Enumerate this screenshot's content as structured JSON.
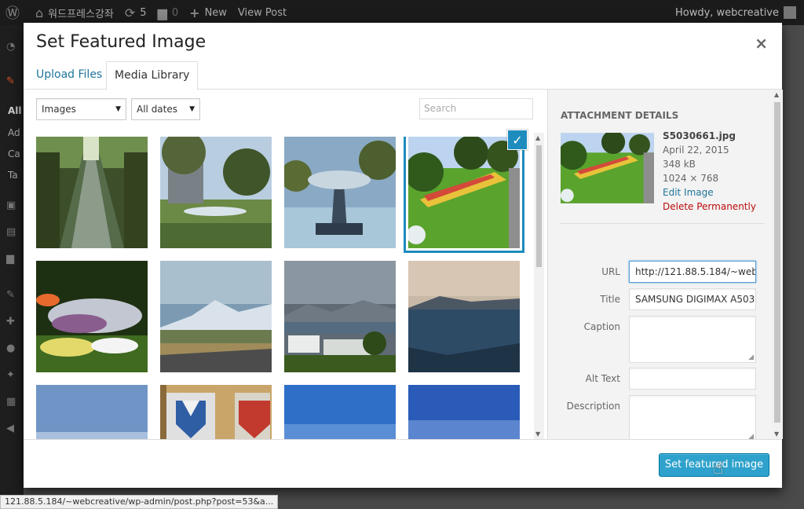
{
  "adminbar": {
    "site_name": "워드프레스강좌",
    "updates_count": "5",
    "comments_count": "0",
    "new_label": "New",
    "view_post_label": "View Post",
    "howdy": "Howdy, webcreative"
  },
  "menu": {
    "items_text": [
      "All",
      "Ad",
      "Ca",
      "Ta"
    ]
  },
  "modal": {
    "title": "Set Featured Image",
    "close_glyph": "×",
    "tabs": [
      {
        "label": "Upload Files",
        "active": false
      },
      {
        "label": "Media Library",
        "active": true
      }
    ]
  },
  "toolbar": {
    "type_filter": "Images",
    "date_filter": "All dates",
    "search_placeholder": "Search"
  },
  "attachments": [
    {
      "name": "canal-trees",
      "selected": false
    },
    {
      "name": "park-fountain-tree",
      "selected": false
    },
    {
      "name": "fountain-statue",
      "selected": false
    },
    {
      "name": "garden-lawn",
      "selected": true
    },
    {
      "name": "flower-bed",
      "selected": false
    },
    {
      "name": "snowy-mountains-road",
      "selected": false
    },
    {
      "name": "lake-town",
      "selected": false
    },
    {
      "name": "lake-shore",
      "selected": false
    },
    {
      "name": "blue-sky-1",
      "selected": false
    },
    {
      "name": "coat-of-arms",
      "selected": false
    },
    {
      "name": "blue-sky-2",
      "selected": false
    },
    {
      "name": "blue-sky-3",
      "selected": false
    }
  ],
  "details": {
    "heading": "Attachment Details",
    "filename": "S5030661.jpg",
    "date": "April 22, 2015",
    "filesize": "348 kB",
    "dimensions": "1024 × 768",
    "edit_link": "Edit Image",
    "delete_link": "Delete Permanently",
    "fields": {
      "url_label": "URL",
      "url_value": "http://121.88.5.184/~webc",
      "title_label": "Title",
      "title_value": "SAMSUNG DIGIMAX A503",
      "caption_label": "Caption",
      "alt_label": "Alt Text",
      "description_label": "Description"
    }
  },
  "footer": {
    "primary_button": "Set featured image"
  },
  "status_url": "121.88.5.184/~webcreative/wp-admin/post.php?post=53&a..."
}
